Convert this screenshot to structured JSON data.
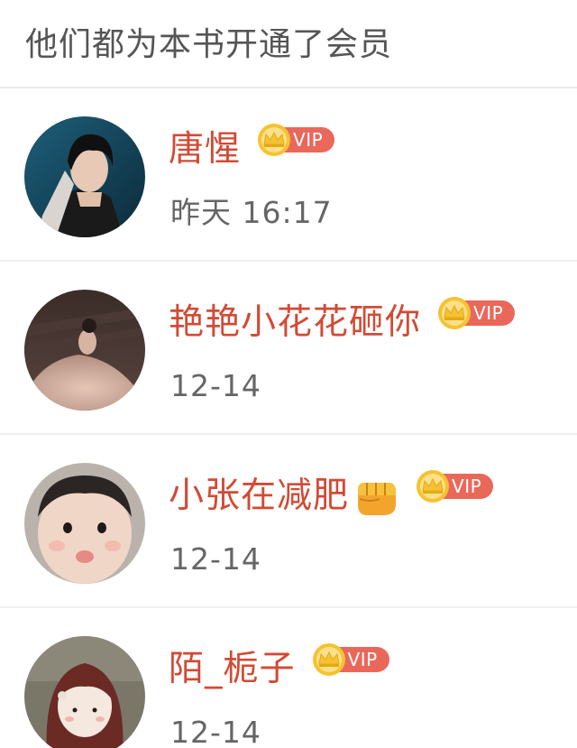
{
  "header": {
    "title": "他们都为本书开通了会员"
  },
  "badge": {
    "label": "VIP"
  },
  "members": [
    {
      "name": "唐惺",
      "time": "昨天 16:17",
      "avatar_icon": "avatar-man-dark"
    },
    {
      "name": "艳艳小花花砸你",
      "time": "12-14",
      "avatar_icon": "avatar-woman-gown"
    },
    {
      "name": "小张在减肥",
      "time": "12-14",
      "avatar_icon": "avatar-baby",
      "emoji_icon": "fist-emoji-icon"
    },
    {
      "name": "陌_栀子",
      "time": "12-14",
      "avatar_icon": "avatar-cartoon-girl"
    }
  ],
  "colors": {
    "name": "#d24a35",
    "vip_pill": "#e9685a",
    "crown": "#f6c231",
    "time": "#666666",
    "title": "#555555"
  }
}
